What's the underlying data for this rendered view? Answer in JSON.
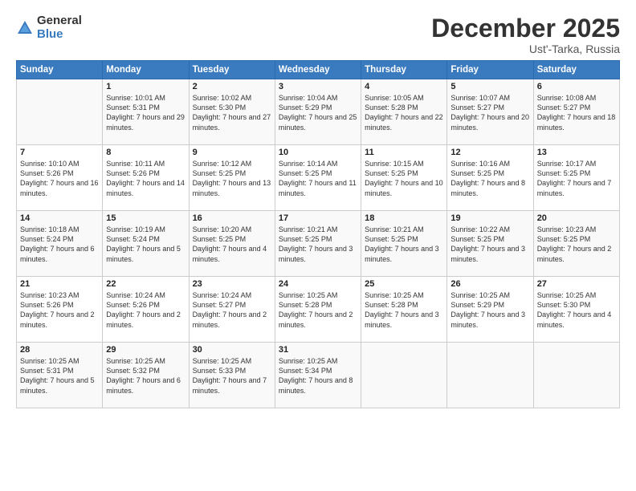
{
  "logo": {
    "general": "General",
    "blue": "Blue"
  },
  "title": "December 2025",
  "location": "Ust'-Tarka, Russia",
  "days": [
    "Sunday",
    "Monday",
    "Tuesday",
    "Wednesday",
    "Thursday",
    "Friday",
    "Saturday"
  ],
  "weeks": [
    [
      {
        "date": "",
        "sunrise": "",
        "sunset": "",
        "daylight": ""
      },
      {
        "date": "1",
        "sunrise": "Sunrise: 10:01 AM",
        "sunset": "Sunset: 5:31 PM",
        "daylight": "Daylight: 7 hours and 29 minutes."
      },
      {
        "date": "2",
        "sunrise": "Sunrise: 10:02 AM",
        "sunset": "Sunset: 5:30 PM",
        "daylight": "Daylight: 7 hours and 27 minutes."
      },
      {
        "date": "3",
        "sunrise": "Sunrise: 10:04 AM",
        "sunset": "Sunset: 5:29 PM",
        "daylight": "Daylight: 7 hours and 25 minutes."
      },
      {
        "date": "4",
        "sunrise": "Sunrise: 10:05 AM",
        "sunset": "Sunset: 5:28 PM",
        "daylight": "Daylight: 7 hours and 22 minutes."
      },
      {
        "date": "5",
        "sunrise": "Sunrise: 10:07 AM",
        "sunset": "Sunset: 5:27 PM",
        "daylight": "Daylight: 7 hours and 20 minutes."
      },
      {
        "date": "6",
        "sunrise": "Sunrise: 10:08 AM",
        "sunset": "Sunset: 5:27 PM",
        "daylight": "Daylight: 7 hours and 18 minutes."
      }
    ],
    [
      {
        "date": "7",
        "sunrise": "Sunrise: 10:10 AM",
        "sunset": "Sunset: 5:26 PM",
        "daylight": "Daylight: 7 hours and 16 minutes."
      },
      {
        "date": "8",
        "sunrise": "Sunrise: 10:11 AM",
        "sunset": "Sunset: 5:26 PM",
        "daylight": "Daylight: 7 hours and 14 minutes."
      },
      {
        "date": "9",
        "sunrise": "Sunrise: 10:12 AM",
        "sunset": "Sunset: 5:25 PM",
        "daylight": "Daylight: 7 hours and 13 minutes."
      },
      {
        "date": "10",
        "sunrise": "Sunrise: 10:14 AM",
        "sunset": "Sunset: 5:25 PM",
        "daylight": "Daylight: 7 hours and 11 minutes."
      },
      {
        "date": "11",
        "sunrise": "Sunrise: 10:15 AM",
        "sunset": "Sunset: 5:25 PM",
        "daylight": "Daylight: 7 hours and 10 minutes."
      },
      {
        "date": "12",
        "sunrise": "Sunrise: 10:16 AM",
        "sunset": "Sunset: 5:25 PM",
        "daylight": "Daylight: 7 hours and 8 minutes."
      },
      {
        "date": "13",
        "sunrise": "Sunrise: 10:17 AM",
        "sunset": "Sunset: 5:25 PM",
        "daylight": "Daylight: 7 hours and 7 minutes."
      }
    ],
    [
      {
        "date": "14",
        "sunrise": "Sunrise: 10:18 AM",
        "sunset": "Sunset: 5:24 PM",
        "daylight": "Daylight: 7 hours and 6 minutes."
      },
      {
        "date": "15",
        "sunrise": "Sunrise: 10:19 AM",
        "sunset": "Sunset: 5:24 PM",
        "daylight": "Daylight: 7 hours and 5 minutes."
      },
      {
        "date": "16",
        "sunrise": "Sunrise: 10:20 AM",
        "sunset": "Sunset: 5:25 PM",
        "daylight": "Daylight: 7 hours and 4 minutes."
      },
      {
        "date": "17",
        "sunrise": "Sunrise: 10:21 AM",
        "sunset": "Sunset: 5:25 PM",
        "daylight": "Daylight: 7 hours and 3 minutes."
      },
      {
        "date": "18",
        "sunrise": "Sunrise: 10:21 AM",
        "sunset": "Sunset: 5:25 PM",
        "daylight": "Daylight: 7 hours and 3 minutes."
      },
      {
        "date": "19",
        "sunrise": "Sunrise: 10:22 AM",
        "sunset": "Sunset: 5:25 PM",
        "daylight": "Daylight: 7 hours and 3 minutes."
      },
      {
        "date": "20",
        "sunrise": "Sunrise: 10:23 AM",
        "sunset": "Sunset: 5:25 PM",
        "daylight": "Daylight: 7 hours and 2 minutes."
      }
    ],
    [
      {
        "date": "21",
        "sunrise": "Sunrise: 10:23 AM",
        "sunset": "Sunset: 5:26 PM",
        "daylight": "Daylight: 7 hours and 2 minutes."
      },
      {
        "date": "22",
        "sunrise": "Sunrise: 10:24 AM",
        "sunset": "Sunset: 5:26 PM",
        "daylight": "Daylight: 7 hours and 2 minutes."
      },
      {
        "date": "23",
        "sunrise": "Sunrise: 10:24 AM",
        "sunset": "Sunset: 5:27 PM",
        "daylight": "Daylight: 7 hours and 2 minutes."
      },
      {
        "date": "24",
        "sunrise": "Sunrise: 10:25 AM",
        "sunset": "Sunset: 5:28 PM",
        "daylight": "Daylight: 7 hours and 2 minutes."
      },
      {
        "date": "25",
        "sunrise": "Sunrise: 10:25 AM",
        "sunset": "Sunset: 5:28 PM",
        "daylight": "Daylight: 7 hours and 3 minutes."
      },
      {
        "date": "26",
        "sunrise": "Sunrise: 10:25 AM",
        "sunset": "Sunset: 5:29 PM",
        "daylight": "Daylight: 7 hours and 3 minutes."
      },
      {
        "date": "27",
        "sunrise": "Sunrise: 10:25 AM",
        "sunset": "Sunset: 5:30 PM",
        "daylight": "Daylight: 7 hours and 4 minutes."
      }
    ],
    [
      {
        "date": "28",
        "sunrise": "Sunrise: 10:25 AM",
        "sunset": "Sunset: 5:31 PM",
        "daylight": "Daylight: 7 hours and 5 minutes."
      },
      {
        "date": "29",
        "sunrise": "Sunrise: 10:25 AM",
        "sunset": "Sunset: 5:32 PM",
        "daylight": "Daylight: 7 hours and 6 minutes."
      },
      {
        "date": "30",
        "sunrise": "Sunrise: 10:25 AM",
        "sunset": "Sunset: 5:33 PM",
        "daylight": "Daylight: 7 hours and 7 minutes."
      },
      {
        "date": "31",
        "sunrise": "Sunrise: 10:25 AM",
        "sunset": "Sunset: 5:34 PM",
        "daylight": "Daylight: 7 hours and 8 minutes."
      },
      {
        "date": "",
        "sunrise": "",
        "sunset": "",
        "daylight": ""
      },
      {
        "date": "",
        "sunrise": "",
        "sunset": "",
        "daylight": ""
      },
      {
        "date": "",
        "sunrise": "",
        "sunset": "",
        "daylight": ""
      }
    ]
  ]
}
